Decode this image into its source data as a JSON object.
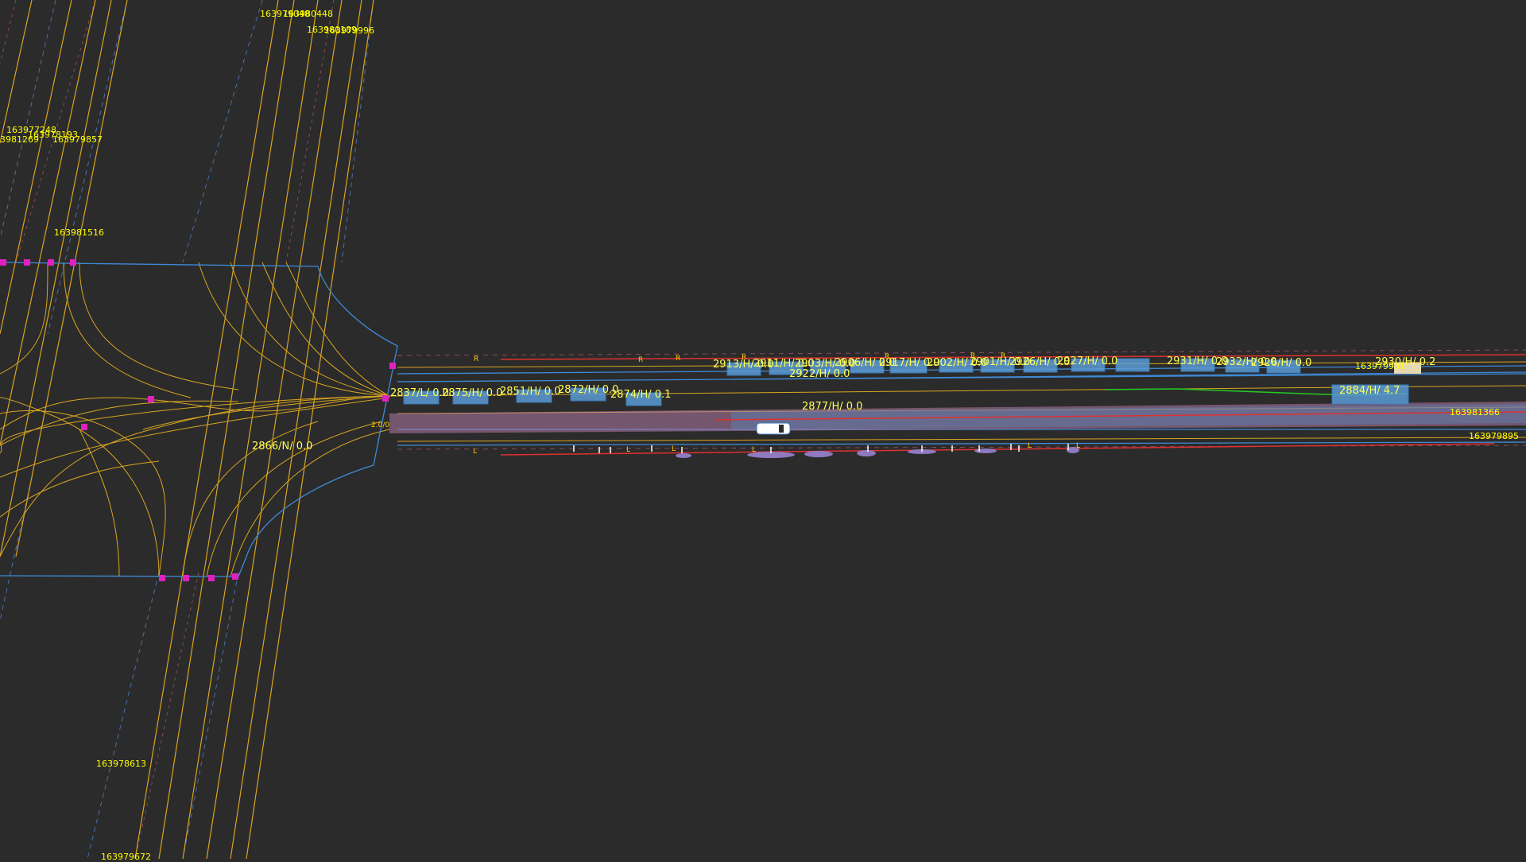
{
  "scene": {
    "background": "#2b2b2b",
    "colors": {
      "lane_center": "#d9a520",
      "road_boundary": "#3e8ad6",
      "lane_divider_dash": "#4a6fa5",
      "curb_red": "#e03030",
      "trajectory_green": "#22cc22",
      "junction_point": "#e020c0",
      "obstacle_fill": "#5a9bd5",
      "label_yellow": "#ffff00",
      "planning_band": "#b07aa6"
    }
  },
  "lane_ids": [
    "163979048",
    "163980448",
    "163980189",
    "163979996",
    "163977248",
    "163978193",
    "163981269",
    "163979857",
    "163981516",
    "163978613",
    "163979672",
    "163981366",
    "163979895",
    "163979951"
  ],
  "obstacle_labels": [
    "2866/N/ 0.0",
    "2837/L/ 0.0",
    "2875/H/ 0.0",
    "2851/H/ 0.0",
    "2872/H/ 0.0",
    "2874/H/ 0.1",
    "2913/H/ 0.0",
    "2911/H/ 0.0",
    "2903/H/ 0.0",
    "2906/H/ 0.0",
    "2917/H/ 0.0",
    "2902/H/ 0.0",
    "2901/H/ 0.0",
    "2926/H/ 0.0",
    "2927/H/ 0.0",
    "2931/H/ 0.0",
    "2932/H/ 0.0",
    "2926/H/ 0.0",
    "2922/H/ 0.0",
    "2877/H/ 0.0",
    "2930/H/ 0.2",
    "2884/H/ 4.7"
  ],
  "small_marks": {
    "right_side": "R",
    "left_side": "L",
    "stop_value": "2.0/0"
  }
}
